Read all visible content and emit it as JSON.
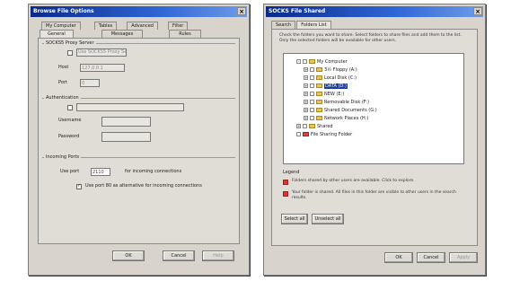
{
  "dialog_left": {
    "title": "Browse File Options",
    "tabs_row1": [
      "My Computer",
      "Tables",
      "Advanced",
      "Filter"
    ],
    "tabs_row2": [
      "General",
      "Messages",
      "Rules"
    ],
    "socks_group": "SOCKS5 Proxy Server",
    "use_proxy_label": "Use SOCKS5 Proxy Server",
    "host_label": "Host",
    "host_value": "127.0.0.1",
    "port_label": "Port",
    "port_value": "0",
    "auth_group": "Authentication",
    "username_label": "Username",
    "password_label": "Password",
    "incoming_group": "Incoming Ports",
    "use_port_label": "Use port",
    "use_port_value": "2110",
    "use_port_desc": "for incoming connections",
    "alt_port_label": "Use port 80 as alternative for incoming connections",
    "buttons": {
      "ok": "OK",
      "cancel": "Cancel",
      "help": "Help"
    }
  },
  "dialog_right": {
    "title": "SOCKS File Shared",
    "tabs": [
      "Search",
      "Folders List"
    ],
    "description": "Check the folders you want to share. Select folders to share files and add them to the list. Only the selected folders will be available for other users.",
    "tree": [
      {
        "indent": 0,
        "label": "My Computer",
        "expand": "-",
        "selected": false
      },
      {
        "indent": 1,
        "label": "3½ Floppy (A:)",
        "expand": "+",
        "selected": false
      },
      {
        "indent": 1,
        "label": "Local Disk (C:)",
        "expand": "+",
        "selected": false
      },
      {
        "indent": 1,
        "label": "DATA (D:)",
        "expand": "+",
        "selected": true
      },
      {
        "indent": 1,
        "label": "NEW (E:)",
        "expand": "+",
        "selected": false
      },
      {
        "indent": 1,
        "label": "Removable Disk (F:)",
        "expand": "+",
        "selected": false
      },
      {
        "indent": 1,
        "label": "Shared Documents (G:)",
        "expand": "+",
        "selected": false
      },
      {
        "indent": 1,
        "label": "Network Places (H:)",
        "expand": "+",
        "selected": false
      },
      {
        "indent": 0,
        "label": "Shared",
        "expand": "+",
        "selected": false
      },
      {
        "indent": 0,
        "label": "File Sharing Folder",
        "expand": "",
        "selected": false,
        "red": true
      }
    ],
    "legend_title": "Legend",
    "legend_items": [
      "Folders shared by other users are available. Click to explore.",
      "Your folder is shared. All files in this folder are visible to other users in the search results."
    ],
    "select_all_button": "Select all",
    "unselect_all_button": "Unselect all",
    "buttons": {
      "ok": "OK",
      "cancel": "Cancel",
      "apply": "Apply"
    }
  },
  "colors": {
    "titlebar": "#0a2a8a",
    "dialog_bg": "#d8d4cc",
    "selection": "#1a3d9a",
    "legend_red": "#d33333"
  }
}
